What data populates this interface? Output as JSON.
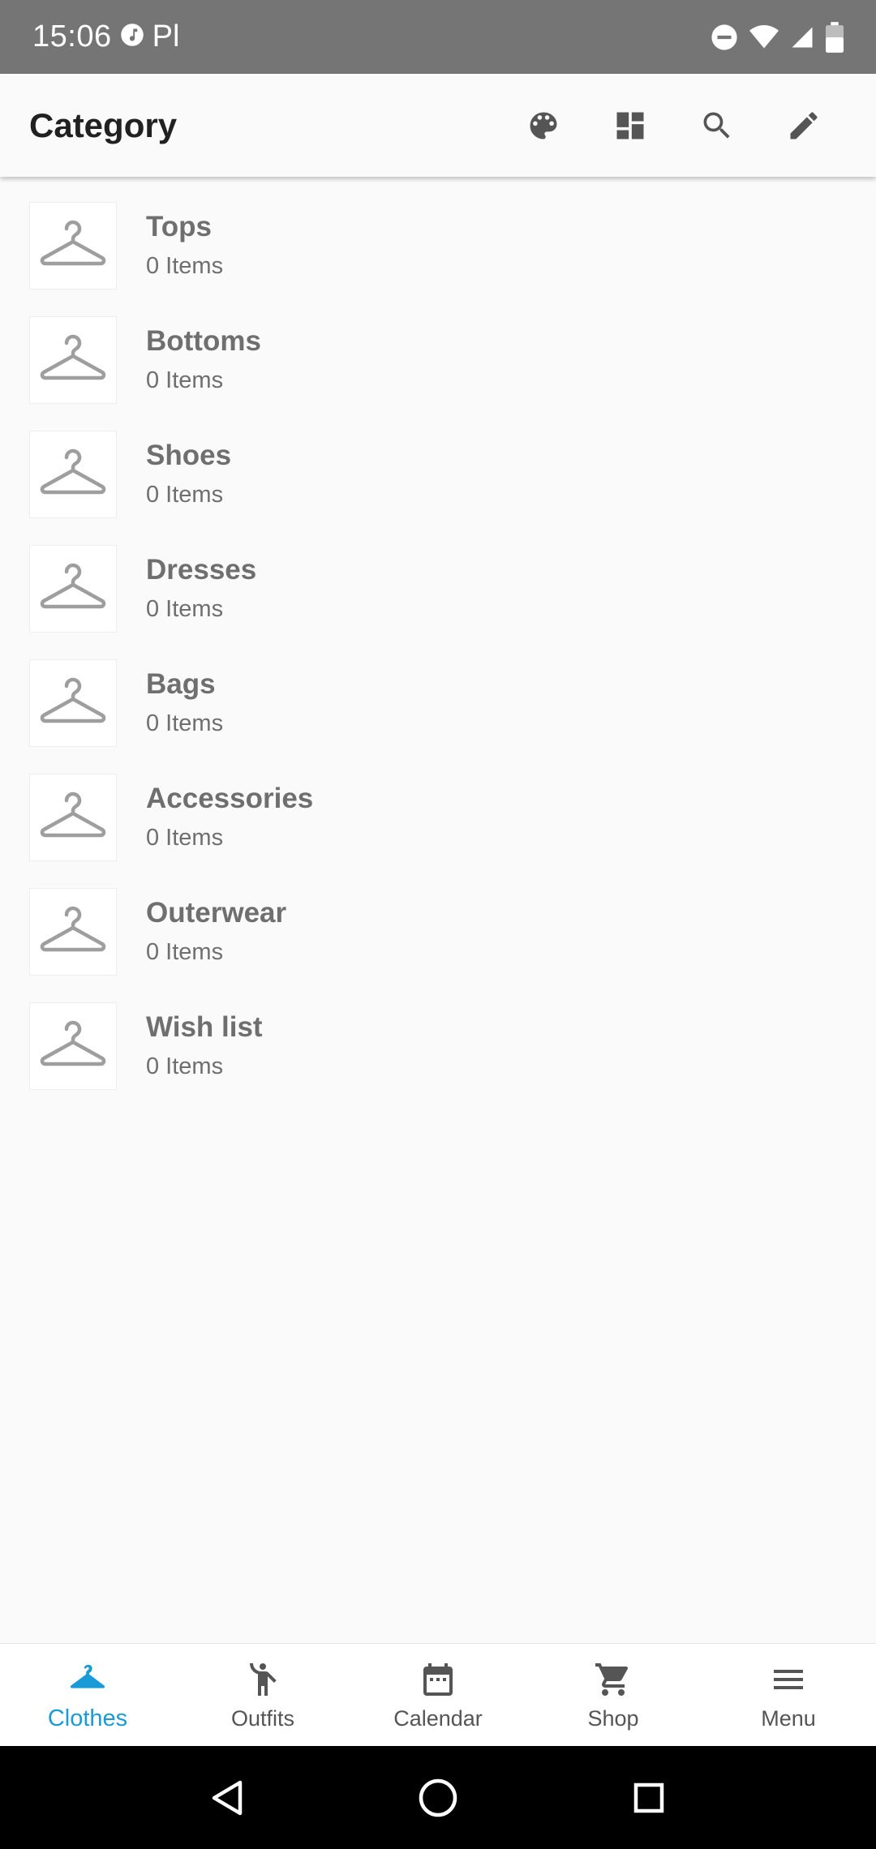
{
  "status_bar": {
    "time": "15:06",
    "carrier": "Pl"
  },
  "app_bar": {
    "title": "Category",
    "actions": [
      "palette-icon",
      "dashboard-icon",
      "search-icon",
      "edit-icon"
    ]
  },
  "categories": [
    {
      "name": "Tops",
      "count": "0 Items"
    },
    {
      "name": "Bottoms",
      "count": "0 Items"
    },
    {
      "name": "Shoes",
      "count": "0 Items"
    },
    {
      "name": "Dresses",
      "count": "0 Items"
    },
    {
      "name": "Bags",
      "count": "0 Items"
    },
    {
      "name": "Accessories",
      "count": "0 Items"
    },
    {
      "name": "Outerwear",
      "count": "0 Items"
    },
    {
      "name": "Wish list",
      "count": "0 Items"
    }
  ],
  "bottom_nav": {
    "items": [
      {
        "label": "Clothes",
        "icon": "hanger-icon",
        "active": true
      },
      {
        "label": "Outfits",
        "icon": "person-icon",
        "active": false
      },
      {
        "label": "Calendar",
        "icon": "calendar-icon",
        "active": false
      },
      {
        "label": "Shop",
        "icon": "cart-icon",
        "active": false
      },
      {
        "label": "Menu",
        "icon": "menu-icon",
        "active": false
      }
    ]
  },
  "colors": {
    "status_bar": "#757575",
    "accent": "#1a9bd7",
    "background": "#fafafa",
    "text_secondary": "#6f6f6f"
  }
}
